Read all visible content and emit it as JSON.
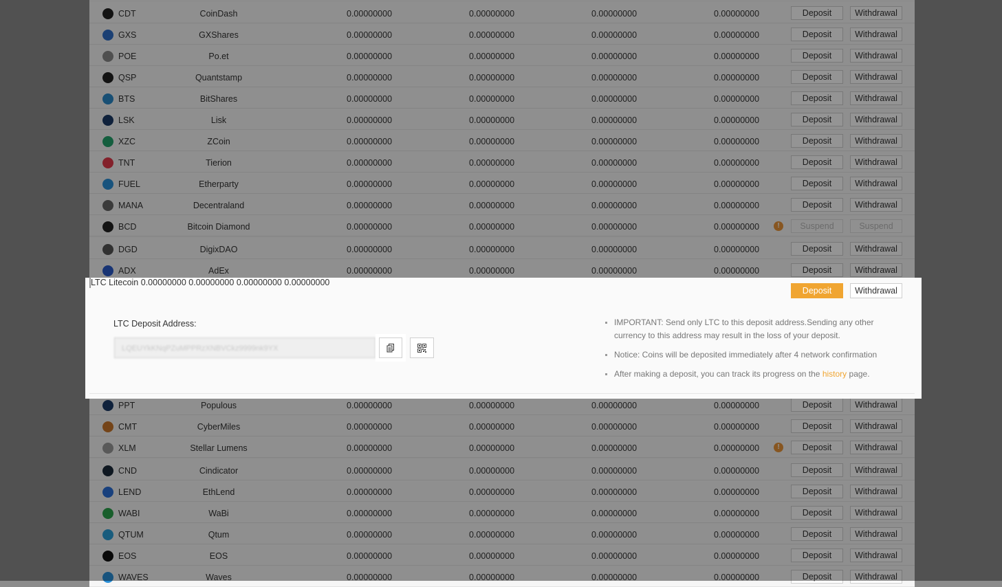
{
  "columns_note": "",
  "rows_top": [
    {
      "sym": "CDT",
      "name": "CoinDash",
      "v": [
        "0.00000000",
        "0.00000000",
        "0.00000000",
        "0.00000000"
      ],
      "deposit": "Deposit",
      "withdraw": "Withdrawal",
      "icon": "coindash-icon",
      "color": "#222"
    },
    {
      "sym": "GXS",
      "name": "GXShares",
      "v": [
        "0.00000000",
        "0.00000000",
        "0.00000000",
        "0.00000000"
      ],
      "deposit": "Deposit",
      "withdraw": "Withdrawal",
      "icon": "gxshares-icon",
      "color": "#2f6fc9"
    },
    {
      "sym": "POE",
      "name": "Po.et",
      "v": [
        "0.00000000",
        "0.00000000",
        "0.00000000",
        "0.00000000"
      ],
      "deposit": "Deposit",
      "withdraw": "Withdrawal",
      "icon": "poet-icon",
      "color": "#888"
    },
    {
      "sym": "QSP",
      "name": "Quantstamp",
      "v": [
        "0.00000000",
        "0.00000000",
        "0.00000000",
        "0.00000000"
      ],
      "deposit": "Deposit",
      "withdraw": "Withdrawal",
      "icon": "quantstamp-icon",
      "color": "#222"
    },
    {
      "sym": "BTS",
      "name": "BitShares",
      "v": [
        "0.00000000",
        "0.00000000",
        "0.00000000",
        "0.00000000"
      ],
      "deposit": "Deposit",
      "withdraw": "Withdrawal",
      "icon": "bitshares-icon",
      "color": "#2a88c9"
    },
    {
      "sym": "LSK",
      "name": "Lisk",
      "v": [
        "0.00000000",
        "0.00000000",
        "0.00000000",
        "0.00000000"
      ],
      "deposit": "Deposit",
      "withdraw": "Withdrawal",
      "icon": "lisk-icon",
      "color": "#1a3a66"
    },
    {
      "sym": "XZC",
      "name": "ZCoin",
      "v": [
        "0.00000000",
        "0.00000000",
        "0.00000000",
        "0.00000000"
      ],
      "deposit": "Deposit",
      "withdraw": "Withdrawal",
      "icon": "zcoin-icon",
      "color": "#24a36c"
    },
    {
      "sym": "TNT",
      "name": "Tierion",
      "v": [
        "0.00000000",
        "0.00000000",
        "0.00000000",
        "0.00000000"
      ],
      "deposit": "Deposit",
      "withdraw": "Withdrawal",
      "icon": "tierion-icon",
      "color": "#e23a4a"
    },
    {
      "sym": "FUEL",
      "name": "Etherparty",
      "v": [
        "0.00000000",
        "0.00000000",
        "0.00000000",
        "0.00000000"
      ],
      "deposit": "Deposit",
      "withdraw": "Withdrawal",
      "icon": "etherparty-icon",
      "color": "#2a8fd8"
    },
    {
      "sym": "MANA",
      "name": "Decentraland",
      "v": [
        "0.00000000",
        "0.00000000",
        "0.00000000",
        "0.00000000"
      ],
      "deposit": "Deposit",
      "withdraw": "Withdrawal",
      "icon": "decentraland-icon",
      "color": "#666"
    },
    {
      "sym": "BCD",
      "name": "Bitcoin Diamond",
      "v": [
        "0.00000000",
        "0.00000000",
        "0.00000000",
        "0.00000000"
      ],
      "deposit": "Suspend",
      "withdraw": "Suspend",
      "icon": "bitcoin-diamond-icon",
      "color": "#222",
      "warn": true,
      "suspended": true
    },
    {
      "sym": "DGD",
      "name": "DigixDAO",
      "v": [
        "0.00000000",
        "0.00000000",
        "0.00000000",
        "0.00000000"
      ],
      "deposit": "Deposit",
      "withdraw": "Withdrawal",
      "icon": "digixdao-icon",
      "color": "#555"
    },
    {
      "sym": "ADX",
      "name": "AdEx",
      "v": [
        "0.00000000",
        "0.00000000",
        "0.00000000",
        "0.00000000"
      ],
      "deposit": "Deposit",
      "withdraw": "Withdrawal",
      "icon": "adex-icon",
      "color": "#2a5ac9"
    }
  ],
  "ltc": {
    "sym": "LTC",
    "name": "Litecoin",
    "v": [
      "0.00000000",
      "0.00000000",
      "0.00000000",
      "0.00000000"
    ],
    "deposit": "Deposit",
    "withdraw": "Withdrawal",
    "address_label": "LTC Deposit Address:",
    "address_value": "LQEUYkKNqPZuMPPRzXNBVCkz9999nk9YX",
    "notes": {
      "n1": "IMPORTANT: Send only LTC to this deposit address.Sending any other currency to this address may result in the loss of your deposit.",
      "n2": "Notice: Coins will be deposited immediately after 4 network confirmation",
      "n3_pre": "After making a deposit, you can track its progress on the",
      "n3_link": "history",
      "n3_post": "page."
    },
    "accent": "#f0a531"
  },
  "rows_bottom": [
    {
      "sym": "PPT",
      "name": "Populous",
      "v": [
        "0.00000000",
        "0.00000000",
        "0.00000000",
        "0.00000000"
      ],
      "deposit": "Deposit",
      "withdraw": "Withdrawal",
      "icon": "populous-icon",
      "color": "#1a3a66"
    },
    {
      "sym": "CMT",
      "name": "CyberMiles",
      "v": [
        "0.00000000",
        "0.00000000",
        "0.00000000",
        "0.00000000"
      ],
      "deposit": "Deposit",
      "withdraw": "Withdrawal",
      "icon": "cybermiles-icon",
      "color": "#c9762a"
    },
    {
      "sym": "XLM",
      "name": "Stellar Lumens",
      "v": [
        "0.00000000",
        "0.00000000",
        "0.00000000",
        "0.00000000"
      ],
      "deposit": "Deposit",
      "withdraw": "Withdrawal",
      "icon": "stellar-icon",
      "color": "#999",
      "warn": true
    },
    {
      "sym": "CND",
      "name": "Cindicator",
      "v": [
        "0.00000000",
        "0.00000000",
        "0.00000000",
        "0.00000000"
      ],
      "deposit": "Deposit",
      "withdraw": "Withdrawal",
      "icon": "cindicator-icon",
      "color": "#1a2a3a"
    },
    {
      "sym": "LEND",
      "name": "EthLend",
      "v": [
        "0.00000000",
        "0.00000000",
        "0.00000000",
        "0.00000000"
      ],
      "deposit": "Deposit",
      "withdraw": "Withdrawal",
      "icon": "ethlend-icon",
      "color": "#2a6fd8"
    },
    {
      "sym": "WABI",
      "name": "WaBi",
      "v": [
        "0.00000000",
        "0.00000000",
        "0.00000000",
        "0.00000000"
      ],
      "deposit": "Deposit",
      "withdraw": "Withdrawal",
      "icon": "wabi-icon",
      "color": "#2aa34a"
    },
    {
      "sym": "QTUM",
      "name": "Qtum",
      "v": [
        "0.00000000",
        "0.00000000",
        "0.00000000",
        "0.00000000"
      ],
      "deposit": "Deposit",
      "withdraw": "Withdrawal",
      "icon": "qtum-icon",
      "color": "#2a9fd8"
    },
    {
      "sym": "EOS",
      "name": "EOS",
      "v": [
        "0.00000000",
        "0.00000000",
        "0.00000000",
        "0.00000000"
      ],
      "deposit": "Deposit",
      "withdraw": "Withdrawal",
      "icon": "eos-icon",
      "color": "#111"
    },
    {
      "sym": "WAVES",
      "name": "Waves",
      "v": [
        "0.00000000",
        "0.00000000",
        "0.00000000",
        "0.00000000"
      ],
      "deposit": "Deposit",
      "withdraw": "Withdrawal",
      "icon": "waves-icon",
      "color": "#2a8fd8"
    }
  ]
}
